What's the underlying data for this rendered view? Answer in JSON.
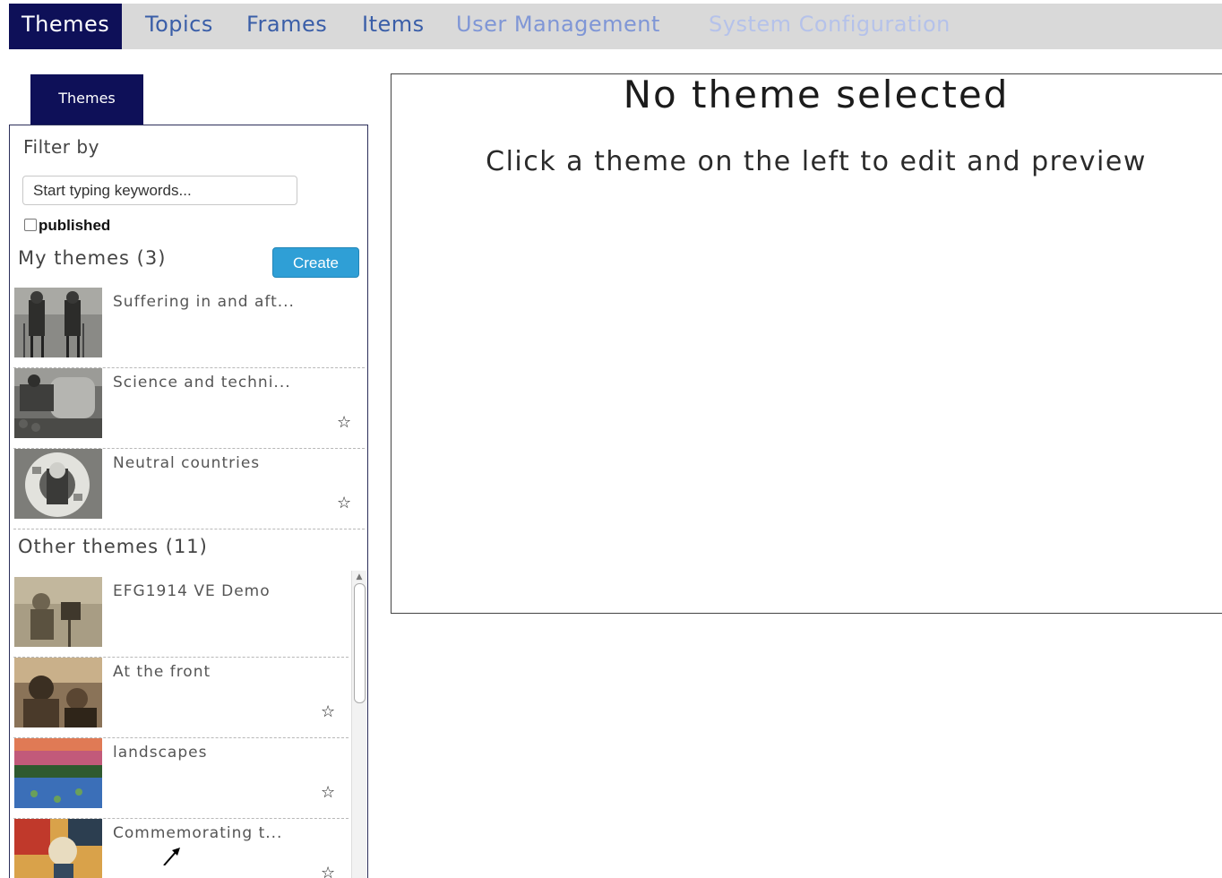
{
  "nav": {
    "tabs": [
      "Themes",
      "Topics",
      "Frames",
      "Items",
      "User Management",
      "System Configuration"
    ],
    "active": "Themes"
  },
  "sidebar": {
    "tab_label": "Themes",
    "filter_label": "Filter by",
    "search_placeholder": "Start typing keywords...",
    "published_label": "published",
    "published_checked": false,
    "my_themes_title": "My themes (3)",
    "create_label": "Create",
    "my_themes": [
      {
        "title": "Suffering in and aft...",
        "starred": false
      },
      {
        "title": "Science and techni...",
        "starred": true
      },
      {
        "title": "Neutral countries",
        "starred": true
      }
    ],
    "other_themes_title": "Other themes (11)",
    "other_themes": [
      {
        "title": "EFG1914 VE Demo",
        "starred": false
      },
      {
        "title": "At the front",
        "starred": true
      },
      {
        "title": "landscapes",
        "starred": true
      },
      {
        "title": "Commemorating t...",
        "starred": true
      }
    ],
    "star_glyph": "☆"
  },
  "main": {
    "title": "No theme selected",
    "subtitle": "Click a theme on the left to edit and preview"
  },
  "colors": {
    "nav_active_bg": "#0e1058",
    "nav_bar_bg": "#d9d9d9",
    "create_button": "#2f9fd6"
  }
}
